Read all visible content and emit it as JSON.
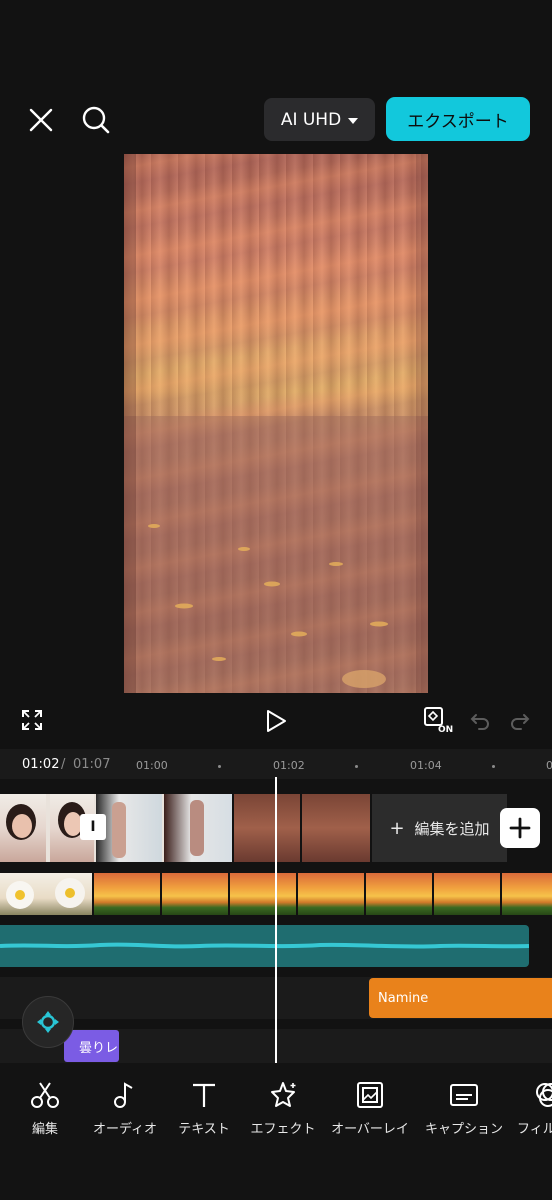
{
  "header": {
    "close_icon": "close-icon",
    "search_icon": "search-icon",
    "resolution_label": "AI UHD",
    "export_label": "エクスポート",
    "export_color": "#12c8dc"
  },
  "player": {
    "fullscreen_icon": "fullscreen-icon",
    "play_icon": "play-icon",
    "keyframe_badge": "ON",
    "undo_icon": "undo-icon",
    "redo_icon": "redo-icon"
  },
  "timeline": {
    "current_time": "01:02",
    "separator": "/",
    "total_time": "01:07",
    "ticks": [
      "01:00",
      "01:02",
      "01:04",
      "0"
    ],
    "add_edit_label": "編集を追加",
    "text_clip_badge": "I",
    "sticker_clip_label": "Namine",
    "effect_clip_label": "曇りレ",
    "audio_color": "#1f6d70",
    "sticker_color": "#e9821b",
    "effect_color": "#7b5ce4"
  },
  "toolbar": {
    "items": [
      {
        "label": "編集",
        "icon": "scissors-icon"
      },
      {
        "label": "オーディオ",
        "icon": "music-note-icon"
      },
      {
        "label": "テキスト",
        "icon": "text-icon"
      },
      {
        "label": "エフェクト",
        "icon": "effect-star-icon"
      },
      {
        "label": "オーバーレイ",
        "icon": "overlay-icon"
      },
      {
        "label": "キャプション",
        "icon": "caption-icon"
      },
      {
        "label": "フィル",
        "icon": "filter-icon"
      }
    ]
  }
}
